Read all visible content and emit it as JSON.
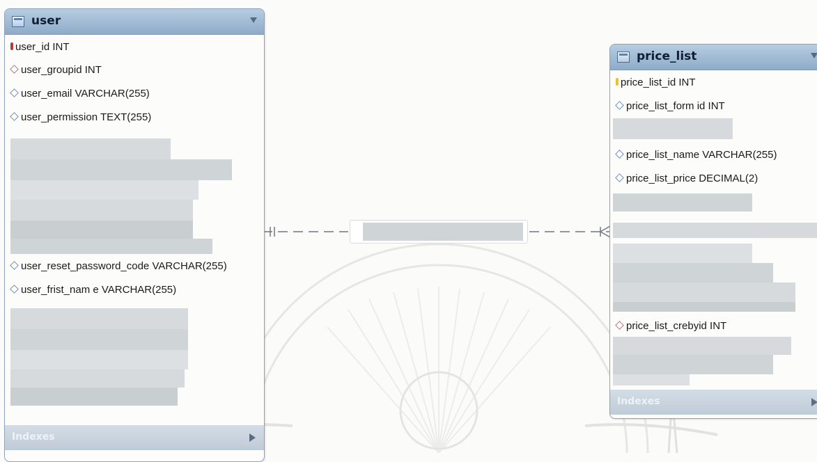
{
  "tables": {
    "user": {
      "title": "user",
      "columns": [
        "user_id INT",
        "user_groupid INT",
        "user_email VARCHAR(255)",
        "user_permission TEXT(255)",
        "user_reset_password_code VARCHAR(255)",
        "user_frist_nam e VARCHAR(255)"
      ],
      "footer": "Indexes"
    },
    "price_list": {
      "title": "price_list",
      "columns": [
        "price_list_id INT",
        "price_list_form id INT",
        "price_list_name VARCHAR(255)",
        "price_list_price DECIMAL(2)",
        "price_list_crebyid INT"
      ],
      "footer": "Indexes"
    }
  },
  "relationship": {
    "from": "user",
    "to": "price_list",
    "cardinality_from": "one-and-only-one",
    "cardinality_to": "one-to-many"
  },
  "icons": {
    "primary_key": "key-icon",
    "column": "diamond-icon",
    "table": "table-icon",
    "collapse": "chevron-down-icon",
    "expand": "chevron-right-icon"
  },
  "colors": {
    "header": "#9fb9d5",
    "border": "#8fa3b8",
    "footer": "#c8d2dd",
    "pk_red": "#b53a3a",
    "pk_yellow": "#e9c324"
  }
}
